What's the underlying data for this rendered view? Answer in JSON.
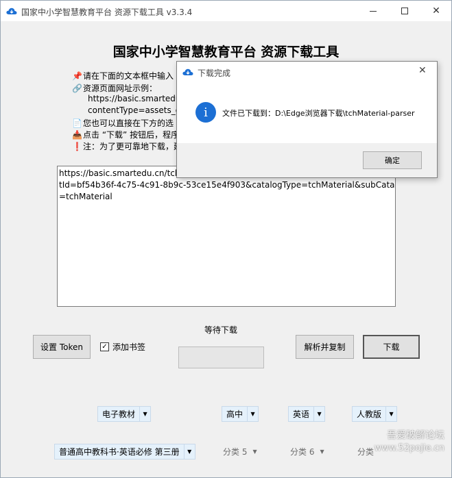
{
  "window": {
    "title": "国家中小学智慧教育平台 资源下载工具 v3.3.4"
  },
  "main": {
    "heading": "国家中小学智慧教育平台 资源下载工具",
    "instructions": [
      {
        "icon": "pin-icon",
        "glyph": "📌",
        "text": "请在下面的文本框中输入"
      },
      {
        "icon": "link-icon",
        "glyph": "🔗",
        "text": "资源页面网址示例："
      },
      {
        "icon": "",
        "glyph": "",
        "text": "https://basic.smartedu"
      },
      {
        "icon": "",
        "glyph": "",
        "text": "contentType=assets_d"
      },
      {
        "icon": "note-icon",
        "glyph": "📄",
        "text": "您也可以直接在下方的选"
      },
      {
        "icon": "download-tray-icon",
        "glyph": "📥",
        "text": "点击 “下载” 按钮后，程序"
      },
      {
        "icon": "exclamation-icon",
        "glyph": "❗",
        "text": "注：为了更可靠地下载，建"
      }
    ],
    "url_text": "https://basic.smartedu.cn/tchN\ntId=bf54b36f-4c75-4c91-8b9c-53ce15e4f903&catalogType=tchMaterial&subCatalog\n=tchMaterial",
    "setup_token_label": "设置 Token",
    "bookmark_label": "添加书签",
    "bookmark_checked": "✓",
    "waiting_label": "等待下载",
    "progress": 0,
    "parse_copy_label": "解析并复制",
    "download_label": "下载"
  },
  "filters": {
    "row1": [
      {
        "value": "电子教材",
        "state": "active"
      },
      {
        "value": "高中",
        "state": "active"
      },
      {
        "value": "英语",
        "state": "active"
      },
      {
        "value": "人教版",
        "state": "active"
      }
    ],
    "row2": [
      {
        "value": "普通高中教科书·英语必修 第三册",
        "state": "active"
      },
      {
        "value": "分类 5",
        "state": "inactive"
      },
      {
        "value": "分类 6",
        "state": "inactive"
      },
      {
        "value": "分类",
        "state": "inactive"
      }
    ]
  },
  "dialog": {
    "title": "下载完成",
    "message": "文件已下载到：D:\\Edge浏览器下载\\tchMaterial-parser",
    "ok_label": "确定"
  },
  "watermark": {
    "line1": "吾爱破解论坛",
    "line2": "www.52pojie.cn"
  },
  "colors": {
    "accent": "#1c6fd4",
    "window_bg": "#f0f0f0",
    "combo_active_bg": "#e5f1fb"
  }
}
